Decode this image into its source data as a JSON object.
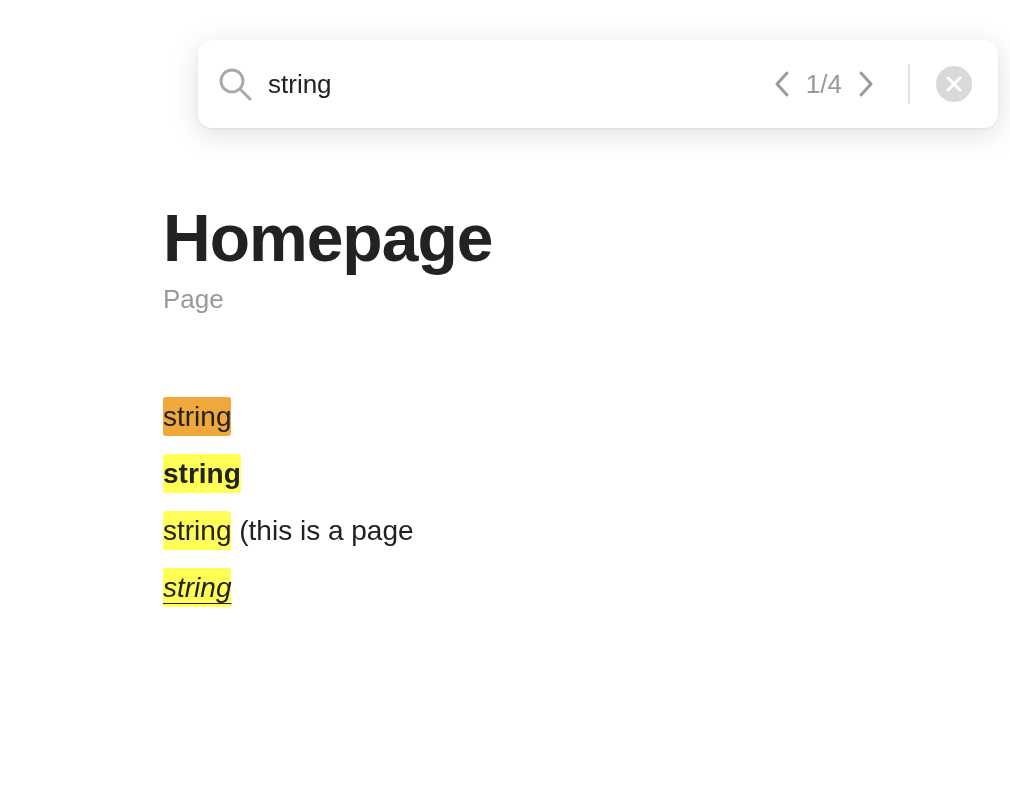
{
  "search": {
    "value": "string",
    "match_counter": "1/4"
  },
  "page": {
    "title": "Homepage",
    "subtitle": "Page"
  },
  "blocks": [
    {
      "kind": "plain",
      "match": "string",
      "selected": true
    },
    {
      "kind": "bold",
      "match": "string",
      "selected": false
    },
    {
      "kind": "plain",
      "match": "string",
      "rest": " (this is a page",
      "selected": false
    },
    {
      "kind": "link",
      "match": "string",
      "selected": false
    }
  ]
}
